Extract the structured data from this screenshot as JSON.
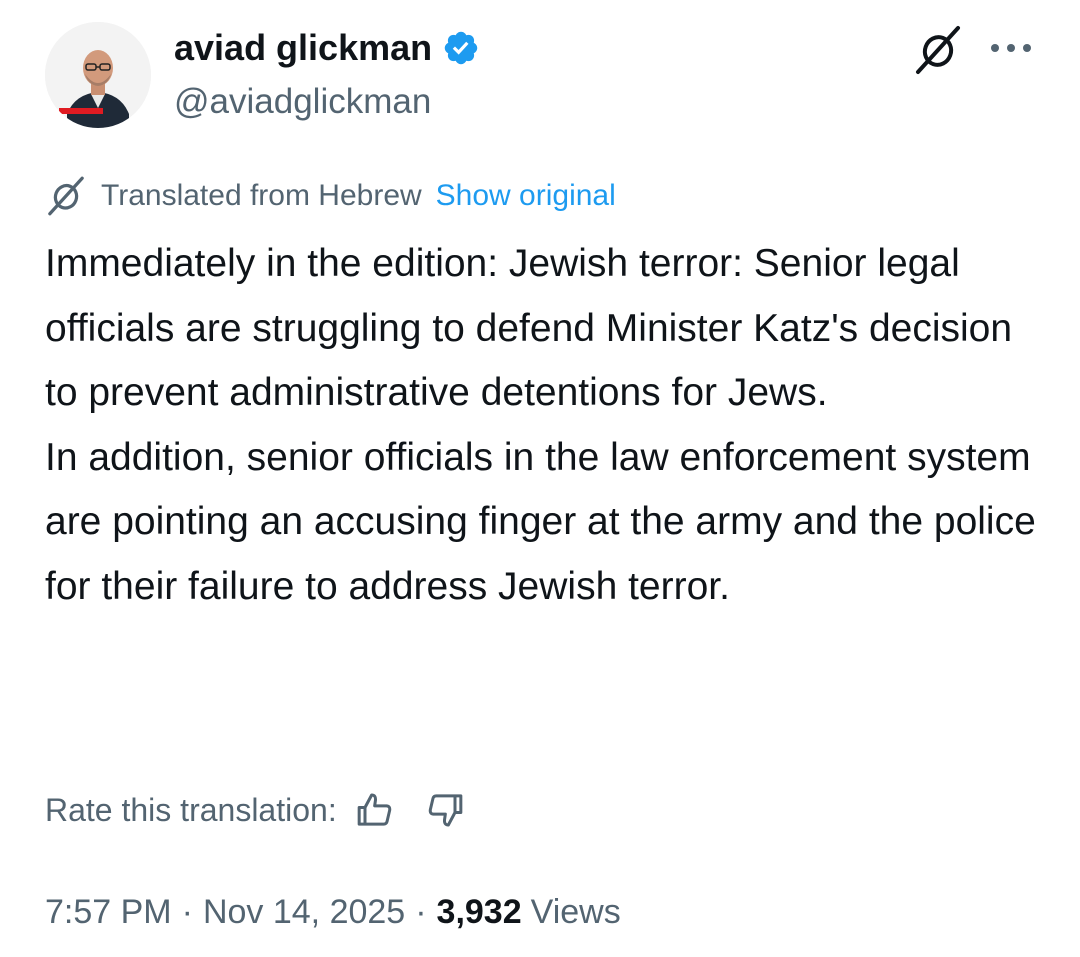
{
  "author": {
    "display_name": "aviad glickman",
    "handle": "@aviadglickman",
    "verified": true,
    "avatar_icon": "profile-photo",
    "avatar_badge_text": "חדשות"
  },
  "header_actions": {
    "grok_icon": "grok-icon",
    "more_icon": "more-options-icon"
  },
  "translation": {
    "label": "Translated from Hebrew",
    "show_original": "Show original",
    "icon": "grok-icon"
  },
  "tweet": {
    "paragraphs": [
      "Immediately in the edition: Jewish terror: Senior legal officials are struggling to defend Minister Katz's decision to prevent administrative detentions for Jews.",
      "In addition, senior officials in the law enforcement system are pointing an accusing finger at the army and the police for their failure to address Jewish terror."
    ]
  },
  "rating": {
    "label": "Rate this translation:",
    "up_icon": "thumbs-up-icon",
    "down_icon": "thumbs-down-icon"
  },
  "meta": {
    "time": "7:57 PM",
    "separator": "·",
    "date": "Nov 14, 2025",
    "views_count": "3,932",
    "views_label": "Views"
  },
  "colors": {
    "text_primary": "#0f1419",
    "text_secondary": "#536471",
    "link": "#1d9bf0",
    "verified": "#1d9bf0"
  }
}
